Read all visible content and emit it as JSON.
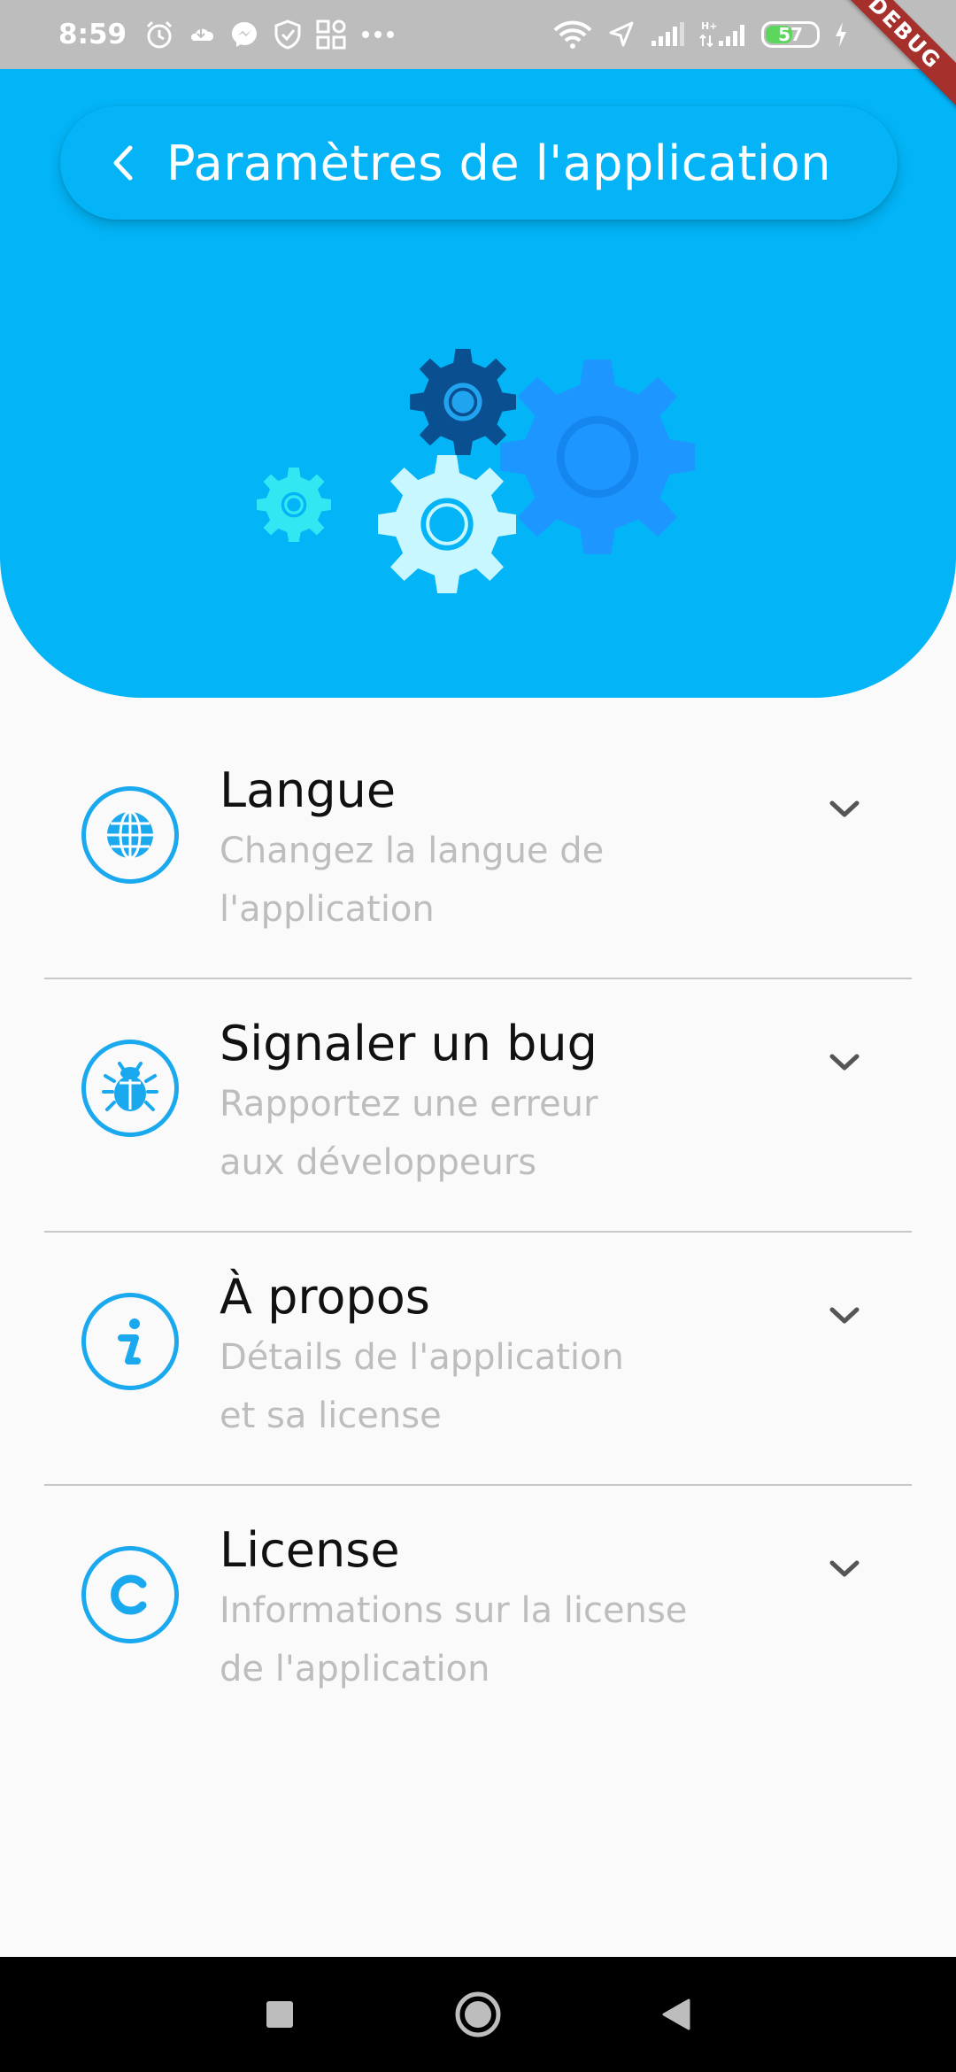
{
  "status_bar": {
    "time": "8:59",
    "battery_level": "57",
    "battery_fraction": 0.57,
    "debug_label": "DEBUG",
    "icons_left": [
      "alarm-icon",
      "cloud-icon",
      "messenger-icon",
      "shield-icon",
      "apps-grid-icon",
      "more-dots-icon"
    ],
    "icons_right": [
      "wifi-icon",
      "location-icon",
      "signal-icon",
      "network-hplus-icon",
      "battery-icon",
      "charging-icon"
    ]
  },
  "header": {
    "title": "Paramètres de l'application",
    "back_icon": "chevron-left-icon",
    "background_color": "#03b4f6",
    "illustration": "gears-illustration"
  },
  "settings": [
    {
      "icon": "globe-icon",
      "title": "Langue",
      "subtitle_line1": "Changez la langue de",
      "subtitle_line2": "l'application"
    },
    {
      "icon": "bug-icon",
      "title": "Signaler un bug",
      "subtitle_line1": "Rapportez une erreur",
      "subtitle_line2": "aux développeurs"
    },
    {
      "icon": "info-icon",
      "title": "À propos",
      "subtitle_line1": "Détails de l'application",
      "subtitle_line2": "et sa license"
    },
    {
      "icon": "copyright-icon",
      "title": "License",
      "subtitle_line1": "Informations sur la license",
      "subtitle_line2": "de l'application"
    }
  ],
  "colors": {
    "accent": "#03b4f6",
    "icon_blue": "#1aa9ee",
    "title_text": "#111111",
    "subtitle_text": "#bdbdbd",
    "divider": "#c8c8c8",
    "debug_ribbon": "#a5302c"
  },
  "nav_bar": {
    "buttons": [
      "recents-square-icon",
      "home-circle-icon",
      "back-triangle-icon"
    ]
  }
}
